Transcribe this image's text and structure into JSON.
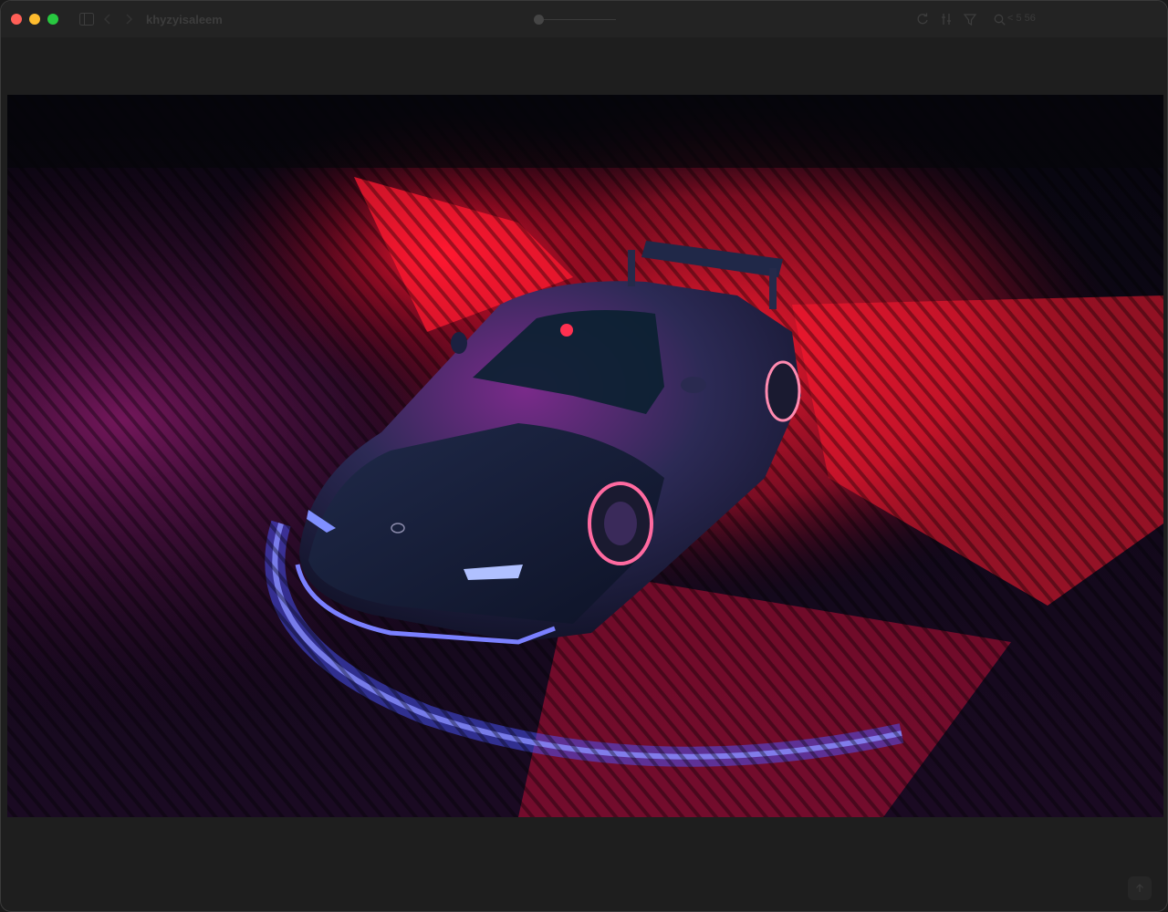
{
  "window": {
    "title": "khyzyisaleem",
    "search_label": "< 5 56"
  },
  "toolbar": {
    "icons": [
      "sidebar-toggle-icon",
      "chevron-left-icon",
      "chevron-right-icon",
      "rotate-icon",
      "adjust-icon",
      "markup-icon",
      "search-icon"
    ]
  },
  "photo": {
    "subject": "car-photo"
  },
  "colors": {
    "window_bg": "#1e1e1e",
    "titlebar_bg": "#232323",
    "close": "#ff5f57",
    "minimize": "#febc2e",
    "maximize": "#28c840",
    "neon_red": "#ff1a2e",
    "neon_blue": "#3a4dff"
  }
}
